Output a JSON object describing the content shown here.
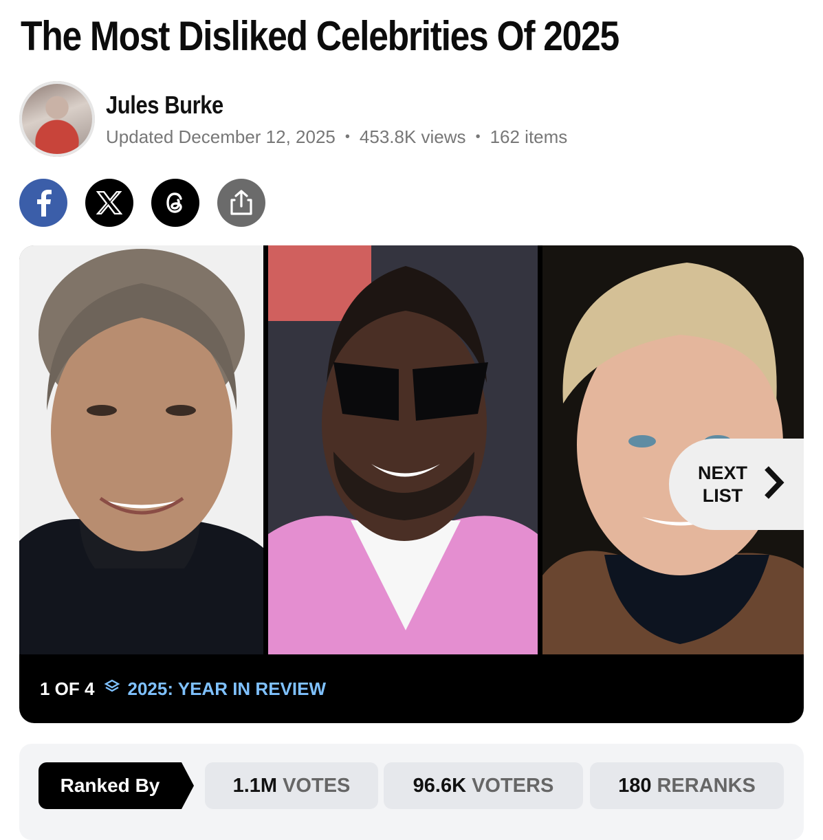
{
  "article": {
    "title": "The Most Disliked Celebrities Of 2025",
    "author": "Jules Burke",
    "updated": "Updated December 12, 2025",
    "views": "453.8K views",
    "items": "162 items"
  },
  "share": [
    {
      "icon": "facebook-icon"
    },
    {
      "icon": "x-icon"
    },
    {
      "icon": "threads-icon"
    },
    {
      "icon": "share-icon"
    }
  ],
  "gallery": {
    "position": "1 OF 4",
    "series": "2025: YEAR IN REVIEW",
    "next_line1": "NEXT",
    "next_line2": "LIST"
  },
  "stats": {
    "ranked_by": "Ranked By",
    "votes_num": "1.1M",
    "votes_unit": "VOTES",
    "voters_num": "96.6K",
    "voters_unit": "VOTERS",
    "reranks_num": "180",
    "reranks_unit": "RERANKS"
  },
  "colors": {
    "facebook": "#3b5ea9",
    "series_link": "#7fc1ff",
    "stats_bg": "#f3f4f6"
  }
}
